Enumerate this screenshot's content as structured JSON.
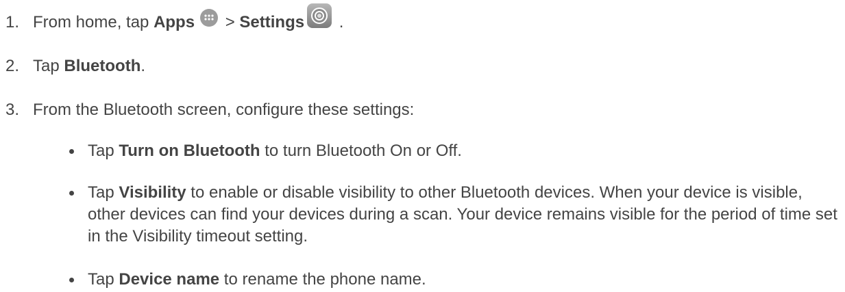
{
  "steps": [
    {
      "num": "1.",
      "pre": "From home, tap ",
      "apps_bold": "Apps",
      "sep": " > ",
      "settings_bold": "Settings",
      "end": " ."
    },
    {
      "num": "2.",
      "pre": "Tap ",
      "bold": "Bluetooth",
      "end": "."
    },
    {
      "num": "3.",
      "text": "From the Bluetooth screen, configure these settings:"
    }
  ],
  "bullets": [
    {
      "pre": "Tap ",
      "bold": "Turn on Bluetooth",
      "post": " to turn Bluetooth On or Off."
    },
    {
      "pre": "Tap ",
      "bold": "Visibility",
      "post": " to enable or disable visibility to other Bluetooth devices. When your device is visible, other devices can find your devices during a scan. Your device remains visible for the period of time set in the Visibility timeout setting."
    },
    {
      "pre": "Tap ",
      "bold": "Device name",
      "post": " to rename the phone name."
    }
  ],
  "icons": {
    "apps": "apps-grid-icon",
    "settings": "settings-gear-icon"
  },
  "colors": {
    "text": "#444444",
    "icon_gray": "#9c9c9c"
  }
}
